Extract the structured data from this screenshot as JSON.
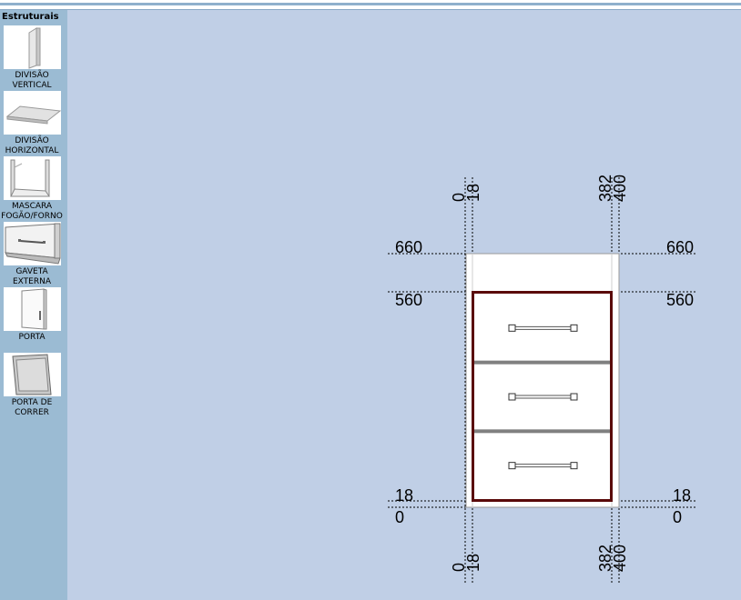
{
  "sidebar": {
    "title": "Estruturais",
    "tools": [
      {
        "label": "DIVISÃO\nVERTICAL",
        "icon": "vertical-divider-icon"
      },
      {
        "label": "DIVISÃO\nHORIZONTAL",
        "icon": "horizontal-shelf-icon"
      },
      {
        "label": "MASCARA\nFOGÃO/FORNO",
        "icon": "stove-oven-mask-icon"
      },
      {
        "label": "GAVETA\nEXTERNA",
        "icon": "external-drawer-icon"
      },
      {
        "label": "PORTA",
        "icon": "door-icon"
      },
      {
        "label": "PORTA DE\nCORRER",
        "icon": "sliding-door-icon"
      }
    ]
  },
  "drawing": {
    "top_x_labels": [
      "0",
      "18",
      "382",
      "400"
    ],
    "bottom_x_labels": [
      "0",
      "18",
      "382",
      "400"
    ],
    "left_y_labels": [
      "660",
      "560",
      "18",
      "0"
    ],
    "right_y_labels": [
      "660",
      "560",
      "18",
      "0"
    ],
    "drawer_count": 3
  },
  "colors": {
    "background": "#c0cfe6",
    "sidebar": "#9bbbd3",
    "frame_outline": "#5a0a0a",
    "separator": "#808080"
  }
}
